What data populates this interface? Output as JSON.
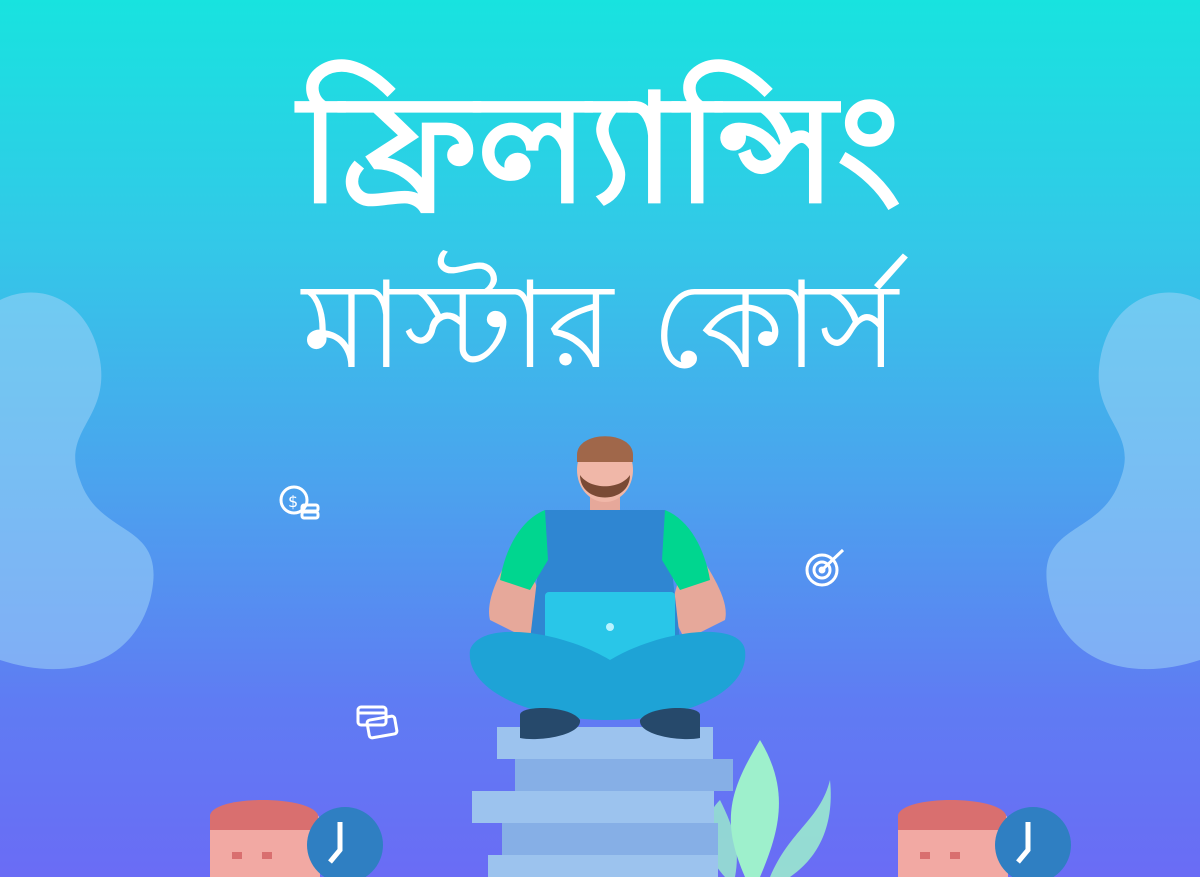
{
  "poster": {
    "title_line1": "ফ্রিল্যান্সিং",
    "title_line2": "মাস্টার কোর্স"
  },
  "colors": {
    "bg_top": "#18e3df",
    "bg_bottom": "#6a6cf5",
    "shirt_green": "#00d68f",
    "pants_blue": "#1ea3d6",
    "laptop": "#29c6e8",
    "books": "#8bb4ea",
    "plant": "#9ef0cc"
  },
  "icons": [
    "dollar-coins-icon",
    "target-icon",
    "credit-card-icon"
  ]
}
